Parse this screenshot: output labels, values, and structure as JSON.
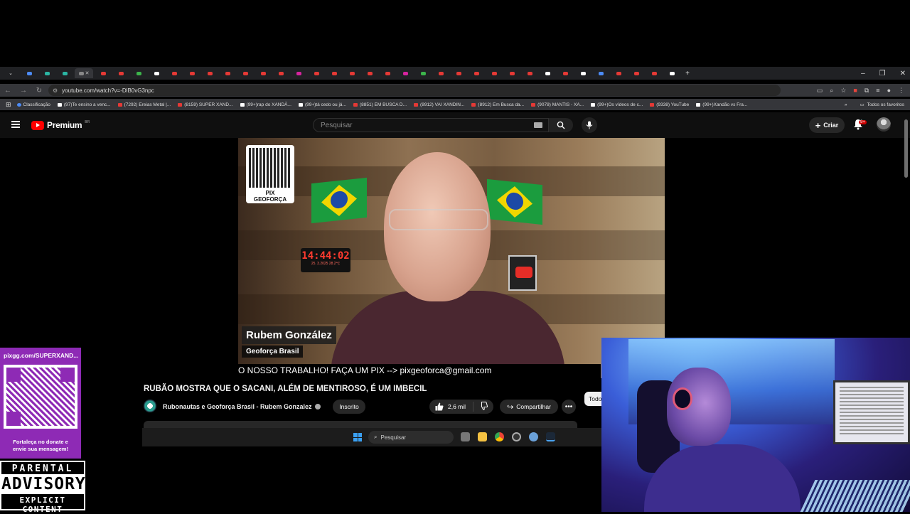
{
  "browser": {
    "url": "youtube.com/watch?v=-DlB0vG3npc",
    "bookmarks": [
      {
        "label": "Classificação",
        "kind": "gl"
      },
      {
        "label": "(97)Te ensino a venc...",
        "kind": "tk"
      },
      {
        "label": "(7292) Ereias Metal |...",
        "kind": "yt"
      },
      {
        "label": "(8159) SUPER XAND...",
        "kind": "yt"
      },
      {
        "label": "(99+)rap do XANDÃ...",
        "kind": "tk"
      },
      {
        "label": "(99+)tá cedo ou já...",
        "kind": "tk"
      },
      {
        "label": "(8851) EM BUSCA D...",
        "kind": "yt"
      },
      {
        "label": "(8912) VAI XANDIN...",
        "kind": "yt"
      },
      {
        "label": "(8912) Em Busca da...",
        "kind": "yt"
      },
      {
        "label": "(9078) MANTIS - XA...",
        "kind": "yt"
      },
      {
        "label": "(99+)Os vídeos de c...",
        "kind": "tk"
      },
      {
        "label": "(9338) YouTube",
        "kind": "yt"
      },
      {
        "label": "(99+)Xandão vs Fra...",
        "kind": "tk"
      }
    ],
    "all_bookmarks_label": "Todos os favoritos",
    "window_controls": [
      "–",
      "❐",
      "✕"
    ]
  },
  "youtube": {
    "logo_text": "Premium",
    "logo_country": "BR",
    "search_placeholder": "Pesquisar",
    "create_label": "Criar",
    "notification_badge": "9+",
    "video": {
      "qr_label": "PIX GEOFORÇA",
      "clock_time": "14:44:02",
      "clock_date": "25. 3.2025   28.2℃",
      "lower_third_name": "Rubem González",
      "lower_third_org": "Geoforça Brasil",
      "ticker_text": "O NOSSO TRABALHO! FAÇA UM PIX --> pixgeoforca@gmail.com"
    },
    "title": "RUBÃO MOSTRA QUE O SACANI, ALÉM DE MENTIROSO, É UM IMBECIL",
    "channel_name": "Rubonautas e Geoforça Brasil - Rubem Gonzalez",
    "subscribe_label": "Inscrito",
    "likes": "2,6 mil",
    "share_label": "Compartilhar",
    "chip_all": "Todos"
  },
  "taskbar": {
    "search_placeholder": "Pesquisar"
  },
  "overlay": {
    "pix_url": "pixgg.com/SUPERXAND...",
    "pix_message_1": "Fortaleça no donate e",
    "pix_message_2": "envie sua mensagem!",
    "advisory_line1": "PARENTAL",
    "advisory_line2": "ADVISORY",
    "advisory_line3": "EXPLICIT CONTENT"
  },
  "colors": {
    "yt_red": "#ff0000",
    "pix_purple": "#8e2ab5",
    "flag_green": "#1b9c3e",
    "flag_yellow": "#f2d600",
    "flag_blue": "#1d4aa6"
  }
}
